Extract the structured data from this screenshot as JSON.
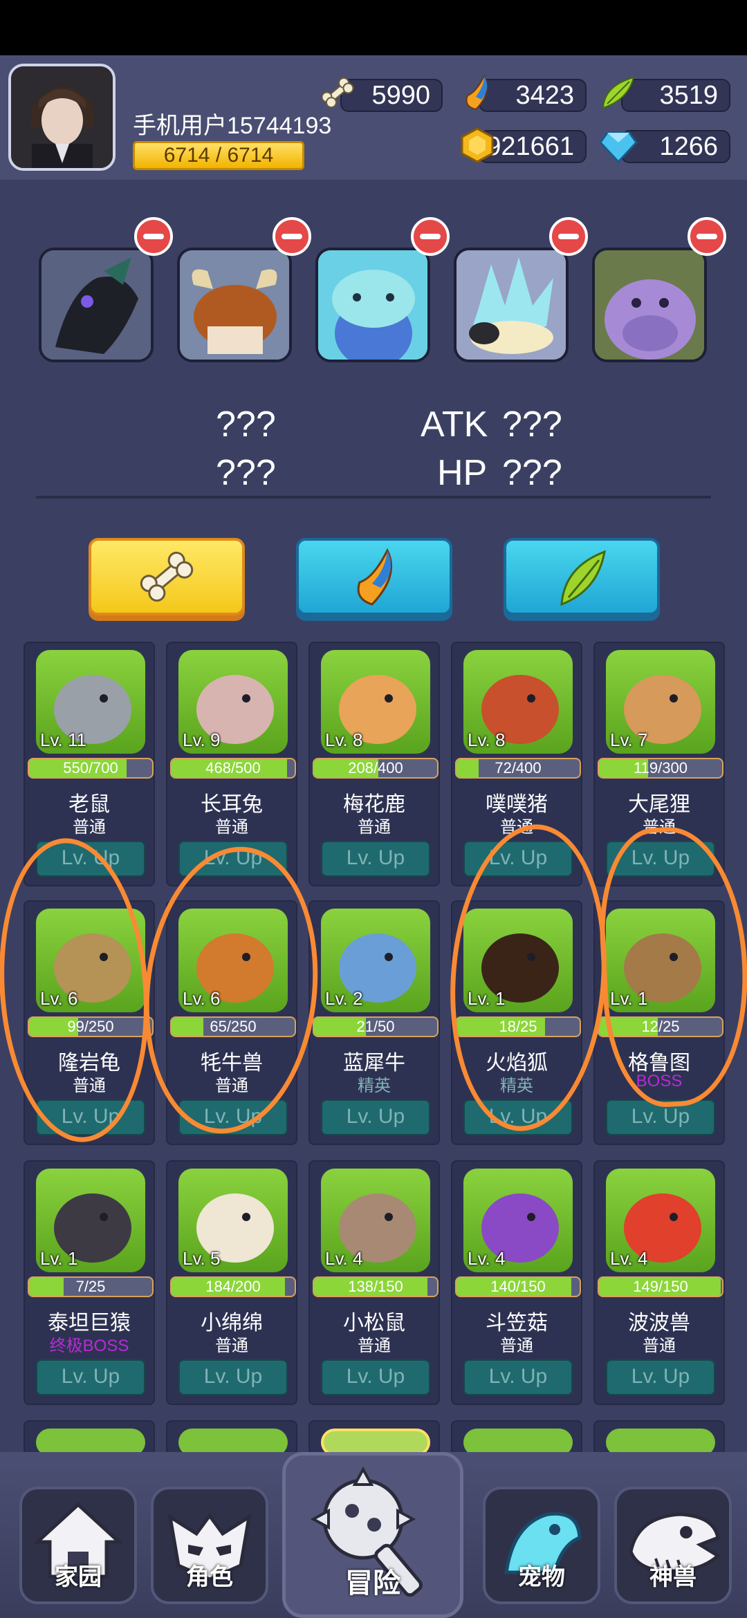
{
  "player": {
    "name": "手机用户15744193",
    "stamina": "6714 / 6714"
  },
  "resources": {
    "bone": "5990",
    "fang": "3423",
    "leaf": "3519",
    "gold": "921661",
    "gem": "1266"
  },
  "team_stats": {
    "left_top": "???",
    "left_bottom": "???",
    "atk_label": "ATK",
    "atk_value": "???",
    "hp_label": "HP",
    "hp_value": "???"
  },
  "filters": [
    "bone",
    "fang",
    "leaf"
  ],
  "pets": [
    {
      "name": "老鼠",
      "rarity": "普通",
      "level": "Lv. 11",
      "xp": "550/700",
      "progress": 0.79,
      "action": "Lv. Up",
      "color": "#9aa0a8"
    },
    {
      "name": "长耳兔",
      "rarity": "普通",
      "level": "Lv. 9",
      "xp": "468/500",
      "progress": 0.94,
      "action": "Lv. Up",
      "color": "#d8b4b0"
    },
    {
      "name": "梅花鹿",
      "rarity": "普通",
      "level": "Lv. 8",
      "xp": "208/400",
      "progress": 0.52,
      "action": "Lv. Up",
      "color": "#e8a458"
    },
    {
      "name": "噗噗猪",
      "rarity": "普通",
      "level": "Lv. 8",
      "xp": "72/400",
      "progress": 0.18,
      "action": "Lv. Up",
      "color": "#c8502c"
    },
    {
      "name": "大尾狸",
      "rarity": "普通",
      "level": "Lv. 7",
      "xp": "119/300",
      "progress": 0.4,
      "action": "Lv. Up",
      "color": "#d69a5a"
    },
    {
      "name": "隆岩龟",
      "rarity": "普通",
      "level": "Lv. 6",
      "xp": "99/250",
      "progress": 0.4,
      "action": "Lv. Up",
      "color": "#b59256"
    },
    {
      "name": "牦牛兽",
      "rarity": "普通",
      "level": "Lv. 6",
      "xp": "65/250",
      "progress": 0.26,
      "action": "Lv. Up",
      "color": "#d27a2e"
    },
    {
      "name": "蓝犀牛",
      "rarity": "精英",
      "level": "Lv. 2",
      "xp": "21/50",
      "progress": 0.42,
      "action": "Lv. Up",
      "color": "#6a9ed6"
    },
    {
      "name": "火焰狐",
      "rarity": "精英",
      "level": "Lv. 1",
      "xp": "18/25",
      "progress": 0.72,
      "action": "Lv. Up",
      "color": "#3a2418"
    },
    {
      "name": "格鲁图",
      "rarity": "BOSS",
      "level": "Lv. 1",
      "xp": "12/25",
      "progress": 0.48,
      "action": "Lv. Up",
      "color": "#a47a48"
    },
    {
      "name": "泰坦巨猿",
      "rarity": "终极BOSS",
      "level": "Lv. 1",
      "xp": "7/25",
      "progress": 0.28,
      "action": "Lv. Up",
      "color": "#3e3a44"
    },
    {
      "name": "小绵绵",
      "rarity": "普通",
      "level": "Lv. 5",
      "xp": "184/200",
      "progress": 0.92,
      "action": "Lv. Up",
      "color": "#efe6d4"
    },
    {
      "name": "小松鼠",
      "rarity": "普通",
      "level": "Lv. 4",
      "xp": "138/150",
      "progress": 0.92,
      "action": "Lv. Up",
      "color": "#a88a74"
    },
    {
      "name": "斗笠菇",
      "rarity": "普通",
      "level": "Lv. 4",
      "xp": "140/150",
      "progress": 0.93,
      "action": "Lv. Up",
      "color": "#8a4ac6"
    },
    {
      "name": "波波兽",
      "rarity": "普通",
      "level": "Lv. 4",
      "xp": "149/150",
      "progress": 0.99,
      "action": "Lv. Up",
      "color": "#e0402c"
    }
  ],
  "nav": {
    "home": "家园",
    "role": "角色",
    "adventure": "冒险",
    "pets": "宠物",
    "beast": "神兽"
  },
  "colors": {
    "rarity_common": "#ffffff",
    "rarity_elite": "#7fb3b6",
    "rarity_boss": "#b62bd6",
    "annotation": "#f98a33"
  }
}
